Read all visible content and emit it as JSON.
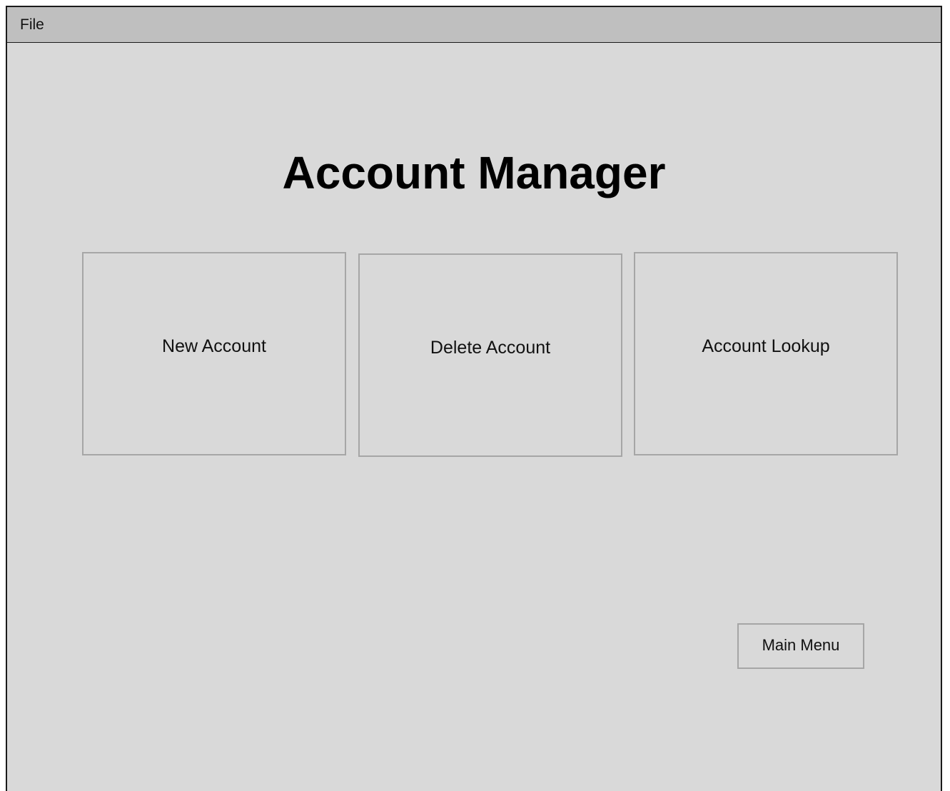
{
  "menubar": {
    "items": [
      {
        "label": "File"
      }
    ]
  },
  "main": {
    "title": "Account Manager",
    "tiles": [
      {
        "label": "New Account"
      },
      {
        "label": "Delete Account"
      },
      {
        "label": "Account Lookup"
      }
    ],
    "main_menu_label": "Main Menu"
  },
  "colors": {
    "window_background": "#d9d9d9",
    "menubar_background": "#bfbfbf",
    "tile_border": "#a6a6a6",
    "window_border": "#1a1a1a"
  }
}
